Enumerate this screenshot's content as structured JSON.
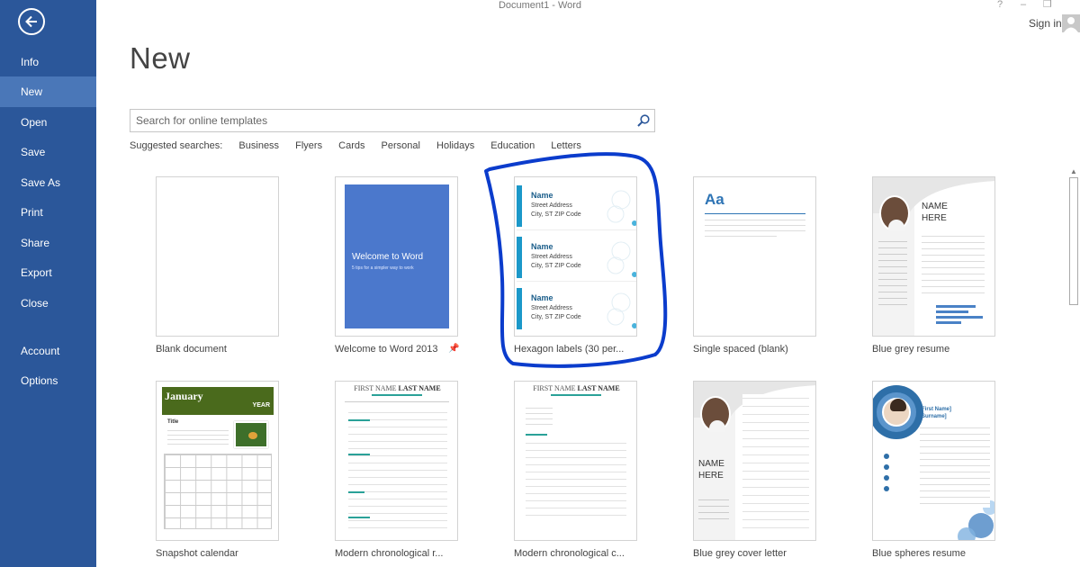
{
  "window": {
    "title": "Document1 - Word",
    "help": "?",
    "minimize": "–",
    "restore": "❐",
    "sign_in": "Sign in"
  },
  "sidebar": {
    "items": [
      {
        "label": "Info"
      },
      {
        "label": "New",
        "active": true
      },
      {
        "label": "Open"
      },
      {
        "label": "Save"
      },
      {
        "label": "Save As"
      },
      {
        "label": "Print"
      },
      {
        "label": "Share"
      },
      {
        "label": "Export"
      },
      {
        "label": "Close"
      },
      {
        "label": "Account"
      },
      {
        "label": "Options"
      }
    ]
  },
  "main": {
    "title": "New",
    "search": {
      "placeholder": "Search for online templates"
    },
    "suggested": {
      "label": "Suggested searches:",
      "links": [
        "Business",
        "Flyers",
        "Cards",
        "Personal",
        "Holidays",
        "Education",
        "Letters"
      ]
    }
  },
  "templates": [
    {
      "name": "Blank document"
    },
    {
      "name": "Welcome to Word 2013",
      "thumb_title": "Welcome to Word",
      "thumb_sub": "5 tips for a simpler way to work"
    },
    {
      "name": "Hexagon labels (30 per...",
      "label_name": "Name",
      "label_addr1": "Street Address",
      "label_addr2": "City, ST ZIP Code"
    },
    {
      "name": "Single spaced (blank)",
      "thumb_text": "Aa"
    },
    {
      "name": "Blue grey resume",
      "thumb_name": "NAME",
      "thumb_name2": "HERE"
    },
    {
      "name": "Snapshot calendar",
      "thumb_month": "January",
      "thumb_year": "YEAR",
      "thumb_title": "Title"
    },
    {
      "name": "Modern chronological r...",
      "thumb_first": "FIRST NAME",
      "thumb_last": "LAST NAME"
    },
    {
      "name": "Modern chronological c...",
      "thumb_first": "FIRST NAME",
      "thumb_last": "LAST NAME"
    },
    {
      "name": "Blue grey cover letter",
      "thumb_name": "NAME",
      "thumb_name2": "HERE"
    },
    {
      "name": "Blue spheres resume",
      "thumb_first": "[First Name]",
      "thumb_last": "[Surname]"
    }
  ],
  "colors": {
    "sidebar": "#2b579a",
    "sidebar_active": "#4a77b8",
    "accent_blue": "#0b3ccc",
    "label_teal": "#1b98c9",
    "calendar_green": "#4a6a1c"
  }
}
